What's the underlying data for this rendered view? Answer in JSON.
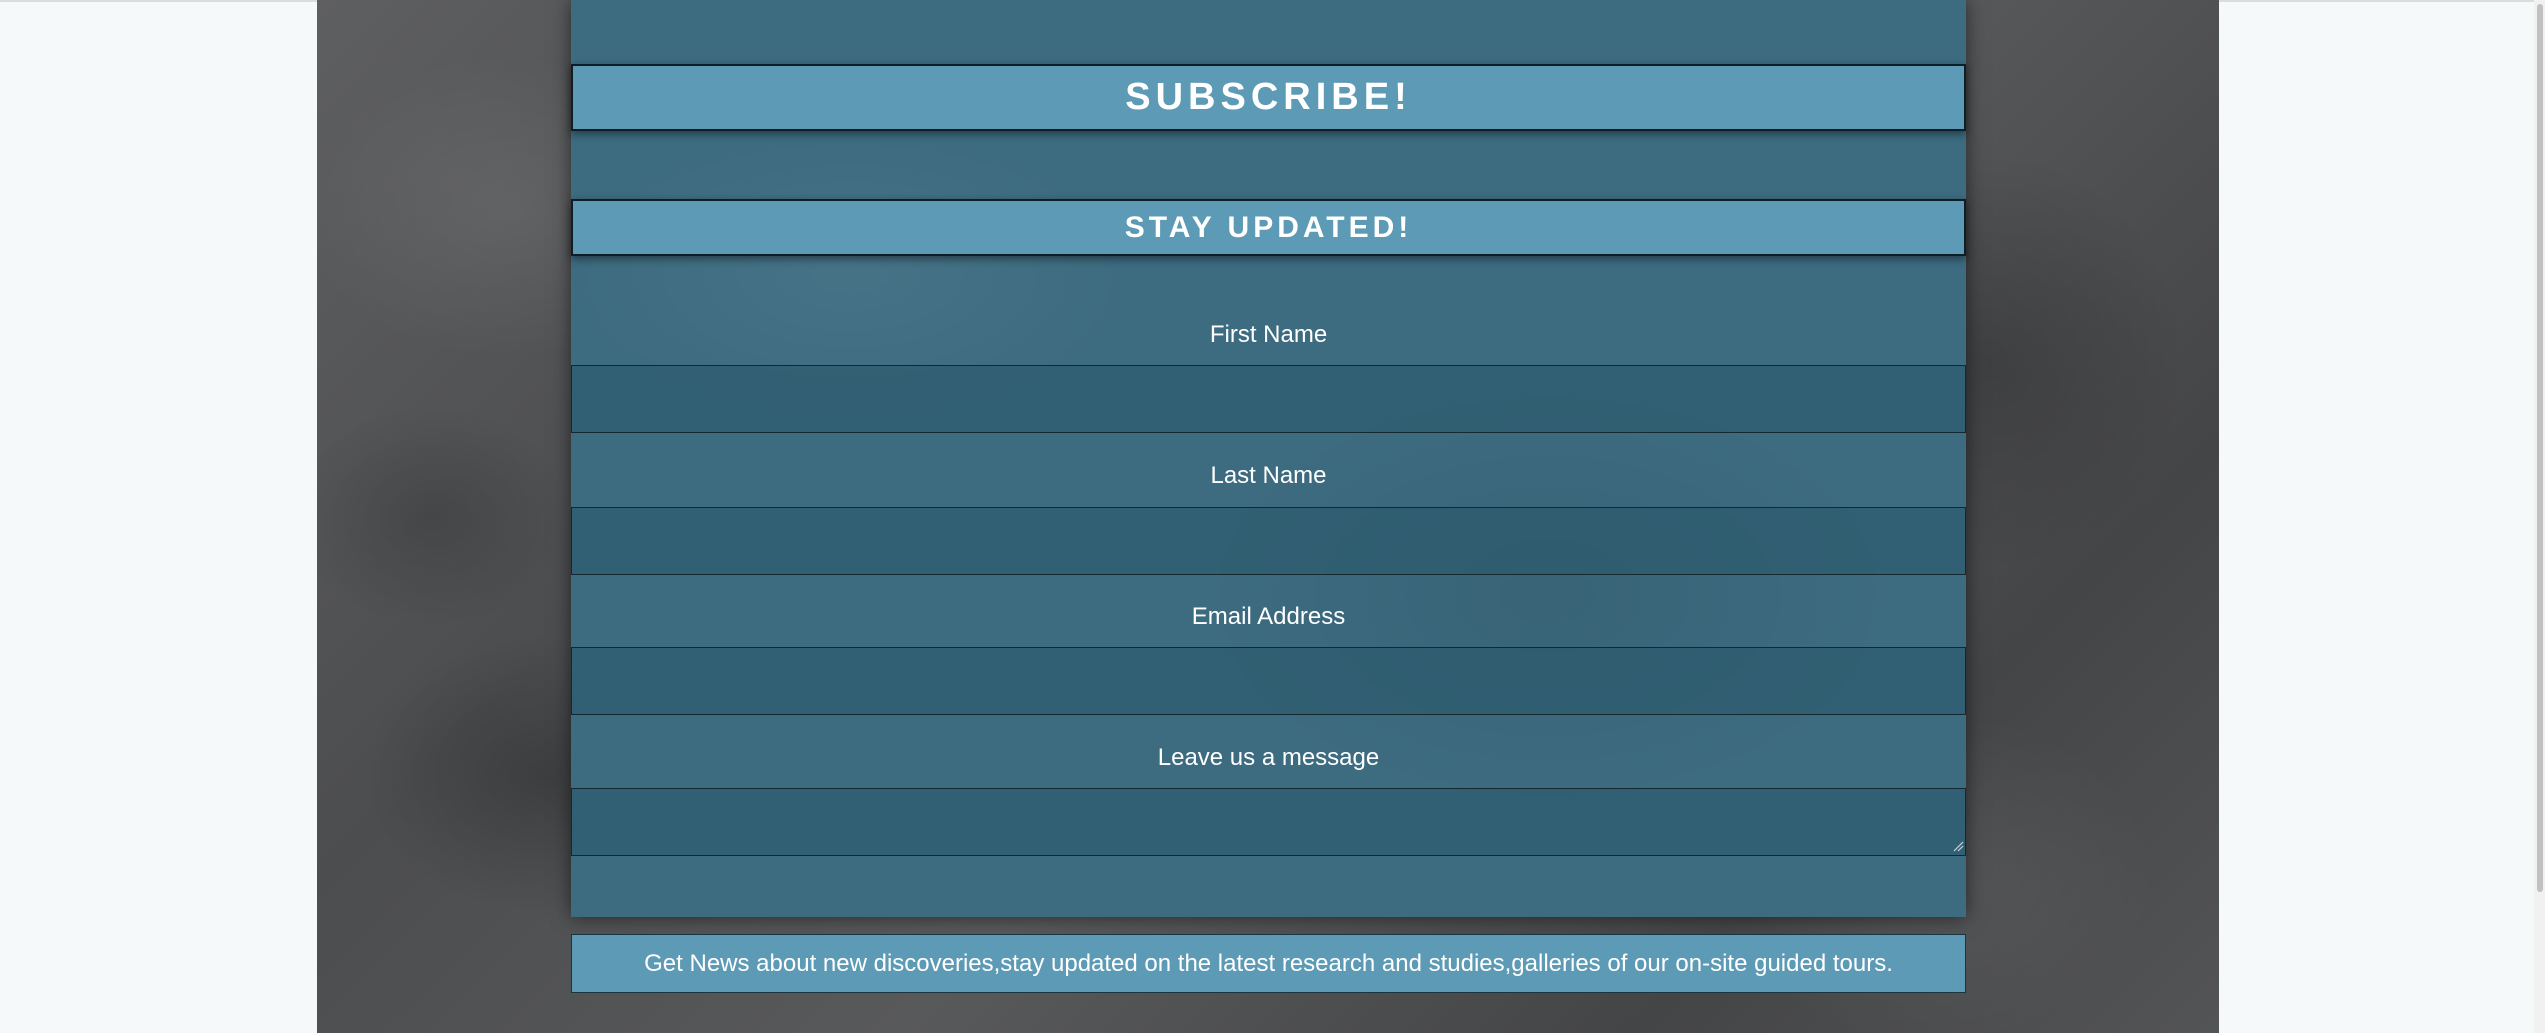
{
  "subscribe_heading": "SUBSCRIBE!",
  "form": {
    "heading": "STAY UPDATED!",
    "fields": [
      {
        "label": "First Name",
        "value": "",
        "placeholder": ""
      },
      {
        "label": "Last Name",
        "value": "",
        "placeholder": ""
      },
      {
        "label": "Email Address",
        "value": "",
        "placeholder": ""
      },
      {
        "label": "Leave us a message",
        "value": "",
        "placeholder": ""
      }
    ]
  },
  "footer_note": "Get News about new discoveries,stay updated on the latest research and studies,galleries of our on-site guided tours.",
  "colors": {
    "page_background": "#f5f9fa",
    "panel": "#3d6b80",
    "banner": "#5d9ab5",
    "stone": "#555658"
  }
}
